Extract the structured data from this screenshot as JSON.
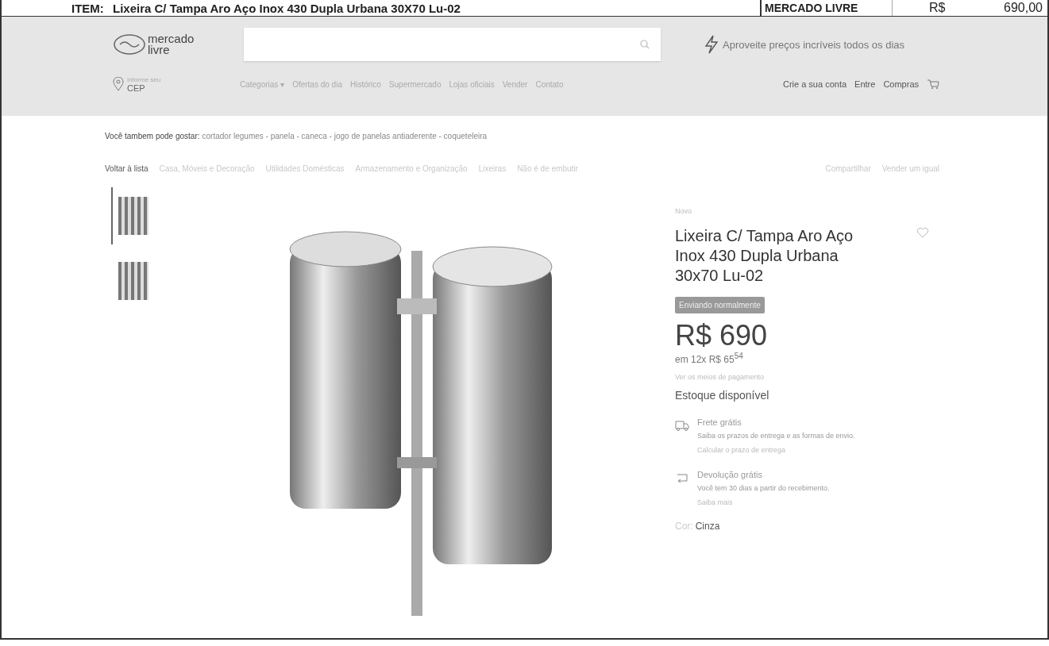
{
  "header": {
    "label": "ITEM:",
    "title": "Lixeira C/ Tampa Aro Aço Inox 430 Dupla Urbana 30X70 Lu-02",
    "store": "MERCADO LIVRE",
    "currency": "R$",
    "price": "690,00"
  },
  "site": {
    "logo_lines": [
      "mercado",
      "livre"
    ],
    "promo": "Aproveite preços incríveis todos os dias",
    "cep": {
      "hint": "Informe seu",
      "label": "CEP"
    },
    "nav": [
      "Categorias ▾",
      "Ofertas do dia",
      "Histórico",
      "Supermercado",
      "Lojas oficiais",
      "Vender",
      "Contato"
    ],
    "account_links": [
      "Crie a sua conta",
      "Entre",
      "Compras"
    ]
  },
  "suggestions": {
    "label": "Você tambem pode gostar:",
    "text": "cortador legumes - panela - caneca - jogo de panelas antiaderente - coqueteleira"
  },
  "breadcrumb": {
    "back": "Voltar à lista",
    "items": [
      "Casa, Móveis e Decoração",
      "Utilidades Domésticas",
      "Armazenamento e Organização",
      "Lixeiras",
      "Não é de embutir"
    ]
  },
  "actions": [
    "Compartilhar",
    "Vender um igual"
  ],
  "thumbnails": [
    {
      "selected": true
    },
    {
      "selected": false
    }
  ],
  "product": {
    "condition": "Novo",
    "title": "Lixeira C/ Tampa Aro Aço Inox 430 Dupla Urbana 30x70 Lu-02",
    "badge": "Enviando normalmente",
    "price": "R$ 690",
    "installments": "em 12x R$ 65$^{54}$",
    "payment_link": "Ver os meios de pagamento",
    "stock": "Estoque disponível",
    "benefits": [
      {
        "kind": "shipping",
        "title": "Frete grátis",
        "detail": "Saiba os prazos de entrega e as formas de envio.",
        "link": "Calcular o prazo de entrega"
      },
      {
        "kind": "return",
        "title": "Devolução grátis",
        "detail": "Você tem 30 dias a partir do recebimento.",
        "link": "Saiba mais"
      }
    ],
    "color": {
      "label": "Cor:",
      "value": "Cinza"
    }
  }
}
